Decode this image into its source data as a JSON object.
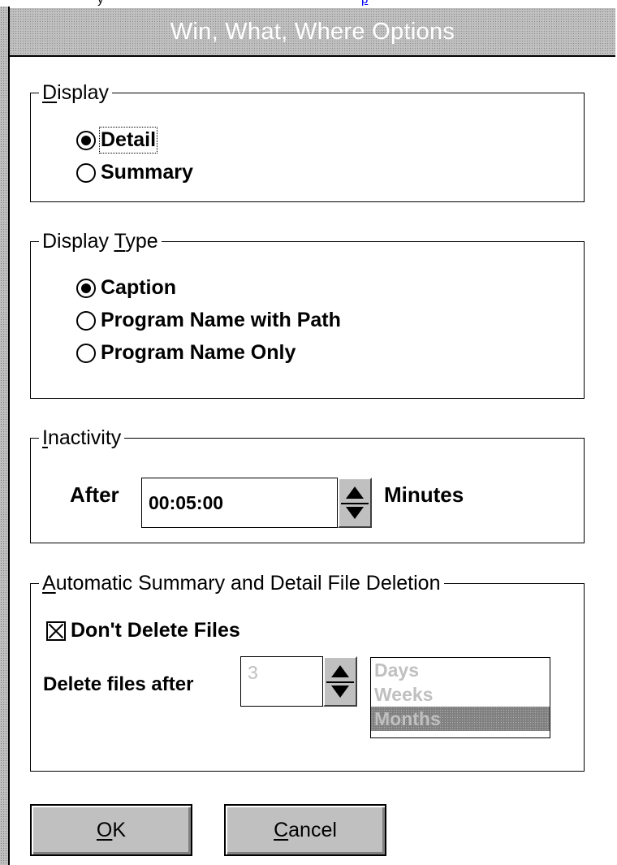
{
  "window": {
    "title": "Win, What, Where Options"
  },
  "background_text": {
    "left": "y",
    "right": "p"
  },
  "display_group": {
    "legend_accel": "D",
    "legend_rest": "isplay",
    "options": [
      "Detail",
      "Summary"
    ],
    "selected_index": 0
  },
  "display_type_group": {
    "legend_pre": "Display ",
    "legend_accel": "T",
    "legend_rest": "ype",
    "options": [
      "Caption",
      "Program Name with Path",
      "Program Name Only"
    ],
    "selected_index": 0
  },
  "inactivity_group": {
    "legend_accel": "I",
    "legend_rest": "nactivity",
    "after_label": "After",
    "time_value": "00:05:00",
    "units_label": "Minutes"
  },
  "deletion_group": {
    "legend_accel": "A",
    "legend_rest": "utomatic Summary and Detail File Deletion",
    "dont_delete_label": "Don't Delete Files",
    "dont_delete_checked": true,
    "delete_after_label": "Delete files after",
    "delete_after_value": "3",
    "period_options": [
      "Days",
      "Weeks",
      "Months"
    ],
    "period_selected": "Months"
  },
  "buttons": {
    "ok_accel": "O",
    "ok_rest": "K",
    "cancel_accel": "C",
    "cancel_rest": "ancel"
  }
}
